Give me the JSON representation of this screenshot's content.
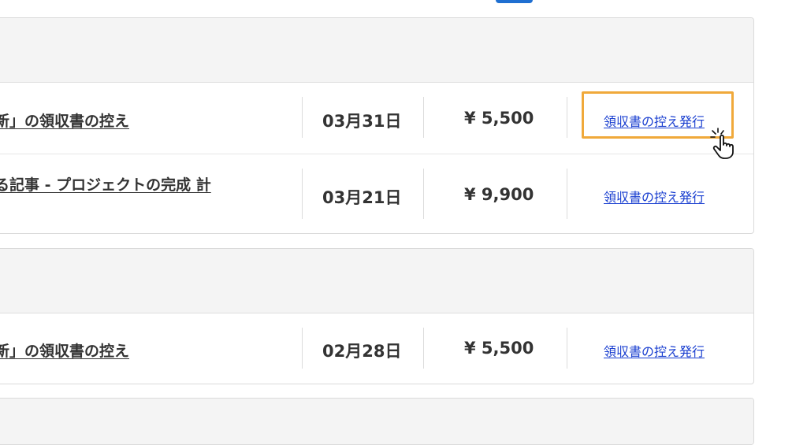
{
  "groups": [
    {
      "rows": [
        {
          "title": "新」の領収書の控え",
          "date": "03月31日",
          "amount": "¥ 5,500",
          "action": "領収書の控え発行"
        },
        {
          "title": "る記事 - プロジェクトの完成 計",
          "date": "03月21日",
          "amount": "¥ 9,900",
          "action": "領収書の控え発行"
        }
      ]
    },
    {
      "rows": [
        {
          "title": "新」の領収書の控え",
          "date": "02月28日",
          "amount": "¥ 5,500",
          "action": "領収書の控え発行"
        }
      ]
    }
  ],
  "colors": {
    "link": "#1a3fd0",
    "highlight": "#f0a93a",
    "header_bg": "#f4f4f4",
    "top_tab": "#1f6fd1"
  },
  "icons": {
    "pointer": "hand-pointer-icon"
  }
}
